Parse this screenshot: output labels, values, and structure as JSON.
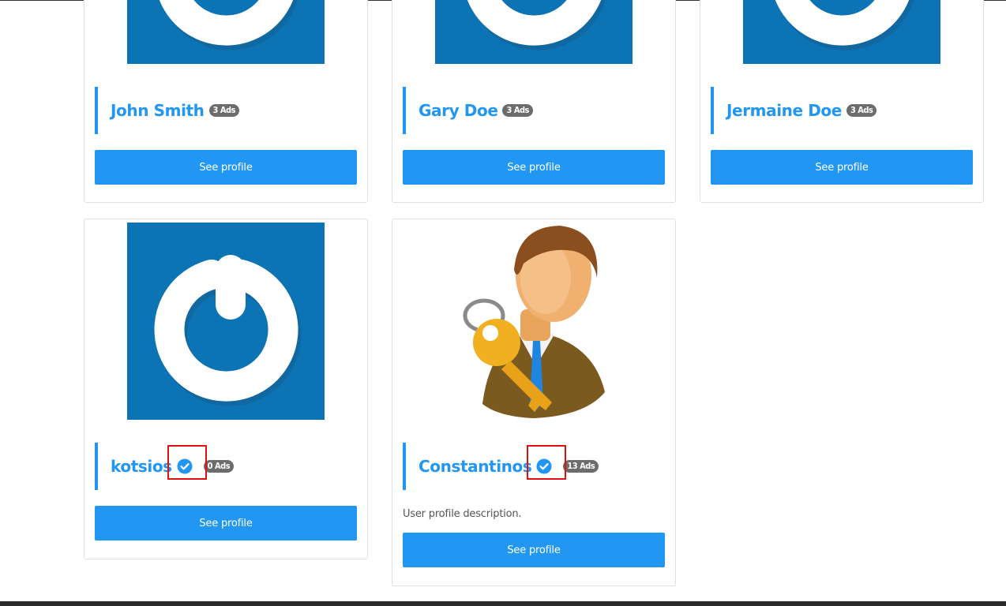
{
  "colors": {
    "accent": "#2196f3",
    "badge": "#6c6c6c",
    "avatar_bg": "#0c74b5",
    "highlight": "#e01010"
  },
  "cards": [
    {
      "name": "John Smith",
      "ads": "3 Ads",
      "verified": false,
      "avatar": "power-logo-icon",
      "button": "See profile"
    },
    {
      "name": "Gary Doe",
      "ads": "3 Ads",
      "verified": false,
      "avatar": "power-logo-icon",
      "button": "See profile"
    },
    {
      "name": "Jermaine Doe",
      "ads": "3 Ads",
      "verified": false,
      "avatar": "power-logo-icon",
      "button": "See profile"
    },
    {
      "name": "kotsios",
      "ads": "0 Ads",
      "verified": true,
      "avatar": "power-logo-icon",
      "button": "See profile"
    },
    {
      "name": "Constantinos",
      "ads": "13 Ads",
      "verified": true,
      "avatar": "user-key-icon",
      "description": "User profile description.",
      "button": "See profile"
    }
  ]
}
